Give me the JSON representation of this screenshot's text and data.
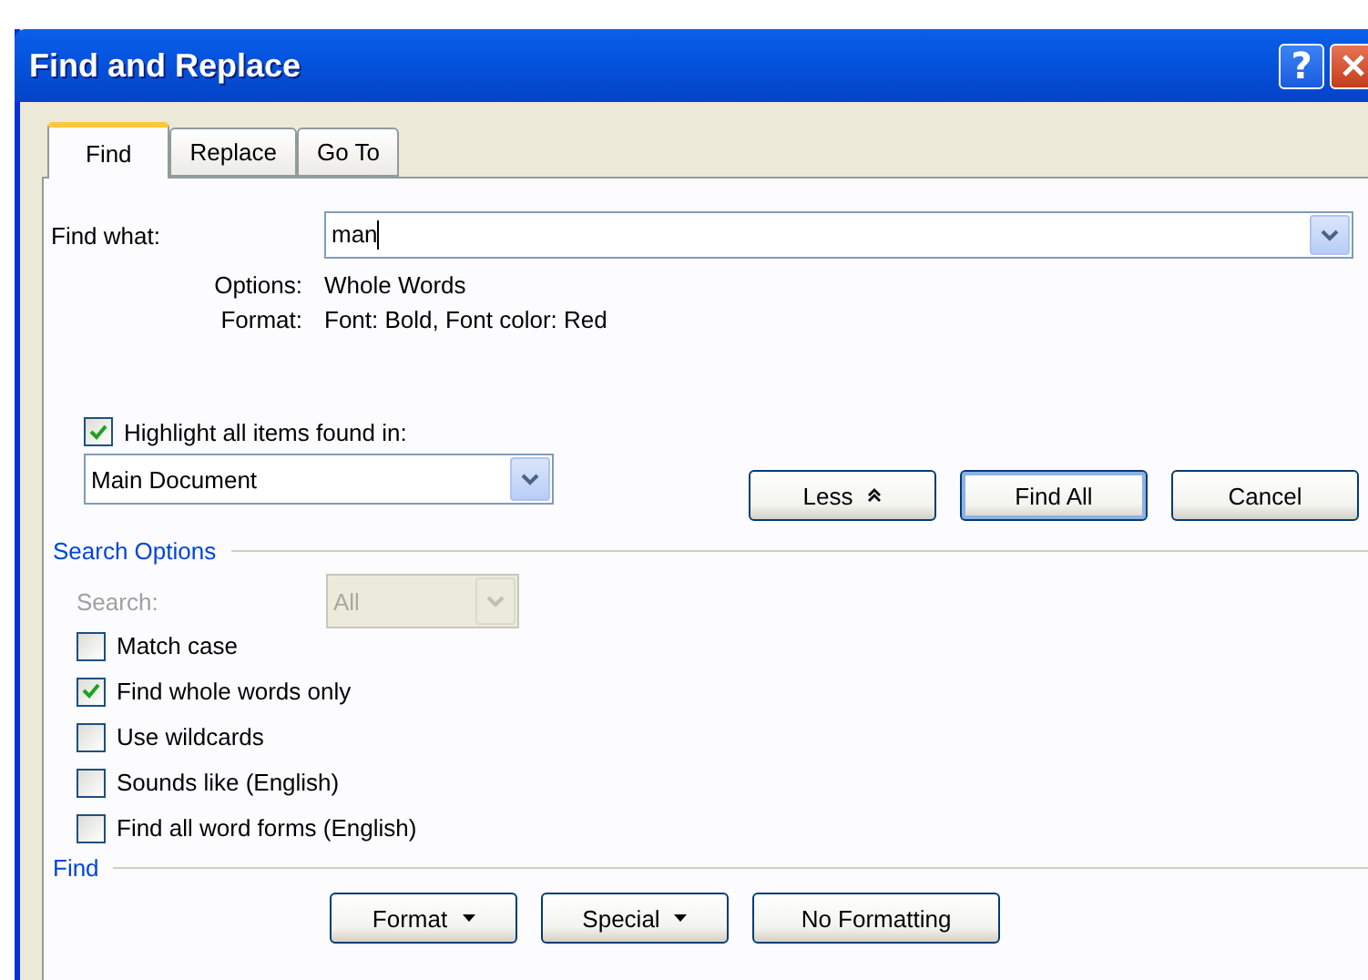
{
  "window": {
    "title": "Find and Replace"
  },
  "title_buttons": [
    {
      "kind": "help",
      "label": "?"
    },
    {
      "kind": "close"
    }
  ],
  "tabs": [
    {
      "label": "Find",
      "selected": true
    },
    {
      "label": "Replace",
      "selected": false
    },
    {
      "label": "Go To",
      "selected": false
    }
  ],
  "find_what": {
    "label": "Find what:",
    "value": "man"
  },
  "criteria": [
    {
      "label": "Options:",
      "value": "Whole Words"
    },
    {
      "label": "Format:",
      "value": "Font: Bold, Font color: Red"
    }
  ],
  "highlight": {
    "label": "Highlight all items found in:",
    "checked": true,
    "scope": "Main Document"
  },
  "actions": [
    {
      "label": "Less",
      "kind": "less",
      "default": false
    },
    {
      "label": "Find All",
      "kind": "plain",
      "default": true
    },
    {
      "label": "Cancel",
      "kind": "plain",
      "default": false
    }
  ],
  "search_options": {
    "heading": "Search Options",
    "search": {
      "label": "Search:",
      "value": "All",
      "disabled": true
    },
    "checkboxes": [
      {
        "label": "Match case",
        "checked": false
      },
      {
        "label": "Find whole words only",
        "checked": true
      },
      {
        "label": "Use wildcards",
        "checked": false
      },
      {
        "label": "Sounds like (English)",
        "checked": false
      },
      {
        "label": "Find all word forms (English)",
        "checked": false
      }
    ]
  },
  "find_section": {
    "heading": "Find",
    "buttons": [
      {
        "label": "Format",
        "menu": true
      },
      {
        "label": "Special",
        "menu": true
      },
      {
        "label": "No Formatting",
        "menu": false
      }
    ]
  }
}
